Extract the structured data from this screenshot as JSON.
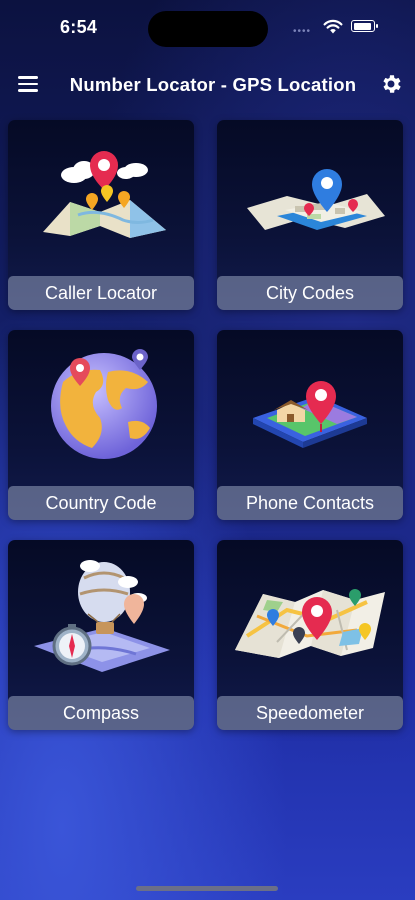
{
  "status_bar": {
    "time": "6:54",
    "dots": "••••"
  },
  "app_bar": {
    "title": "Number Locator - GPS Location",
    "menu_icon": "hamburger-menu-icon",
    "settings_icon": "gear-icon"
  },
  "tiles": [
    {
      "label": "Caller Locator",
      "icon": "map-pin-clouds-icon"
    },
    {
      "label": "City Codes",
      "icon": "city-map-pin-icon"
    },
    {
      "label": "Country Code",
      "icon": "globe-pins-icon"
    },
    {
      "label": "Phone Contacts",
      "icon": "house-map-pin-icon"
    },
    {
      "label": "Compass",
      "icon": "compass-balloon-icon"
    },
    {
      "label": "Speedometer",
      "icon": "folded-map-pins-icon"
    }
  ],
  "colors": {
    "background_top": "#0c1240",
    "background_bottom": "#2a3dc0",
    "tile_label_bg": "#969ebe",
    "pin_red": "#e52b50",
    "pin_blue": "#2f7de0"
  }
}
